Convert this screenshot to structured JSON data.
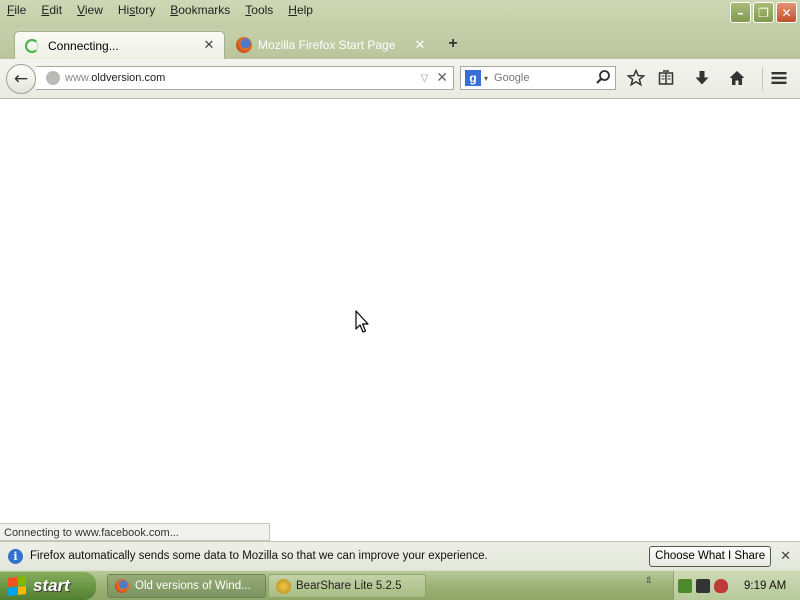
{
  "menu": {
    "items": [
      {
        "pre": "",
        "ul": "F",
        "post": "ile"
      },
      {
        "pre": "",
        "ul": "E",
        "post": "dit"
      },
      {
        "pre": "",
        "ul": "V",
        "post": "iew"
      },
      {
        "pre": "Hi",
        "ul": "s",
        "post": "tory"
      },
      {
        "pre": "",
        "ul": "B",
        "post": "ookmarks"
      },
      {
        "pre": "",
        "ul": "T",
        "post": "ools"
      },
      {
        "pre": "",
        "ul": "H",
        "post": "elp"
      }
    ]
  },
  "window_controls": {
    "minimize": "–",
    "restore": "❐",
    "close": "✕"
  },
  "tabs": [
    {
      "title": "Connecting...",
      "state": "loading",
      "close": "✕"
    },
    {
      "title": "Mozilla Firefox Start Page",
      "state": "inactive",
      "close": "✕"
    }
  ],
  "new_tab_label": "+",
  "navbar": {
    "back": "←",
    "url_prefix": "www.",
    "url_domain": "oldversion.com",
    "url_drop": "▽",
    "url_stop": "✕",
    "search_engine_icon": "g",
    "search_drop": "▾",
    "search_placeholder": "Google"
  },
  "status_text": "Connecting to www.facebook.com...",
  "notification": {
    "info_icon": "i",
    "text": "Firefox automatically sends some data to Mozilla so that we can improve your experience.",
    "button": "Choose What I Share",
    "close": "✕"
  },
  "taskbar": {
    "start_label": "start",
    "tasks": [
      {
        "label": "Old versions of Wind..."
      },
      {
        "label": "BearShare Lite 5.2.5"
      }
    ],
    "tray_toggle": "⇫",
    "clock": "9:19 AM"
  },
  "colors": {
    "chrome_bg": "#c6d0ab",
    "taskbar_green": "#9cb276",
    "start_green": "#4f8030",
    "info_blue": "#3271cc",
    "loading_green": "#45b245"
  },
  "icons": [
    "back-arrow-icon",
    "globe-icon",
    "google-icon",
    "magnifier-icon",
    "star-icon",
    "reading-list-icon",
    "download-icon",
    "home-icon",
    "hamburger-menu-icon",
    "info-icon",
    "windows-logo-icon",
    "firefox-icon",
    "bearshare-icon",
    "mouse-cursor-icon"
  ]
}
